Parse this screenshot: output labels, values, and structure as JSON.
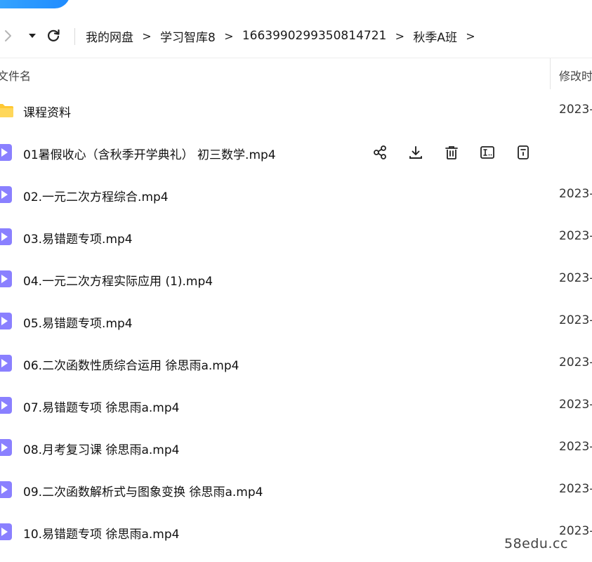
{
  "breadcrumb": {
    "items": [
      "我的网盘",
      "学习智库8",
      "1663990299350814721",
      "秋季A班"
    ],
    "separator": ">"
  },
  "columns": {
    "name": "文件名",
    "modified": "修改时"
  },
  "files": [
    {
      "name": "课程资料",
      "type": "folder",
      "modified": "2023-"
    },
    {
      "name": "01暑假收心（含秋季开学典礼） 初三数学.mp4",
      "type": "video",
      "modified": ""
    },
    {
      "name": "02.一元二次方程综合.mp4",
      "type": "video",
      "modified": "2023-"
    },
    {
      "name": "03.易错题专项.mp4",
      "type": "video",
      "modified": "2023-"
    },
    {
      "name": "04.一元二次方程实际应用 (1).mp4",
      "type": "video",
      "modified": "2023-"
    },
    {
      "name": "05.易错题专项.mp4",
      "type": "video",
      "modified": "2023-"
    },
    {
      "name": "06.二次函数性质综合运用 徐思雨a.mp4",
      "type": "video",
      "modified": "2023-"
    },
    {
      "name": "07.易错题专项 徐思雨a.mp4",
      "type": "video",
      "modified": "2023-"
    },
    {
      "name": "08.月考复习课 徐思雨a.mp4",
      "type": "video",
      "modified": "2023-"
    },
    {
      "name": "09.二次函数解析式与图象变换 徐思雨a.mp4",
      "type": "video",
      "modified": "2023-"
    },
    {
      "name": "10.易错题专项 徐思雨a.mp4",
      "type": "video",
      "modified": "2023-"
    }
  ],
  "watermark": "58edu.cc",
  "colors": {
    "accent": "#1f8bff",
    "folder": "#ffc833",
    "video": "#8a80ff"
  }
}
